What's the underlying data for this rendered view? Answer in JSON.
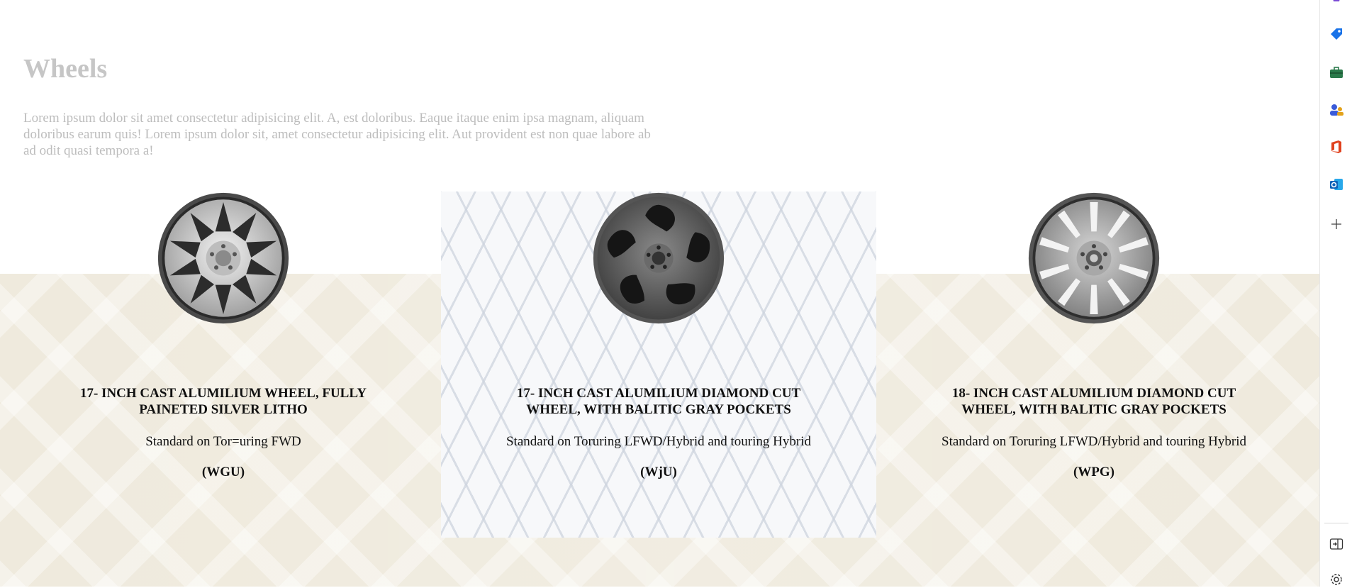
{
  "section": {
    "title": "Wheels",
    "description": "Lorem ipsum dolor sit amet consectetur adipisicing elit. A, est doloribus. Eaque itaque enim ipsa magnam, aliquam doloribus earum quis! Lorem ipsum dolor sit, amet consectetur adipisicing elit. Aut provident est non quae labore ab ad odit quasi tempora a!"
  },
  "cards": [
    {
      "title": "17- INCH CAST ALUMILIUM WHEEL, FULLY PAINETED SILVER LITHO",
      "subtitle": "Standard on Tor=uring FWD",
      "code": "(WGU)"
    },
    {
      "title": "17- INCH CAST ALUMILIUM DIAMOND CUT WHEEL, WITH BALITIC GRAY POCKETS",
      "subtitle": "Standard on Toruring LFWD/Hybrid and touring Hybrid",
      "code": "(WjU)"
    },
    {
      "title": "18- INCH CAST ALUMILIUM DIAMOND CUT WHEEL, WITH BALITIC GRAY POCKETS",
      "subtitle": "Standard on Toruring LFWD/Hybrid and touring Hybrid",
      "code": "(WPG)"
    }
  ],
  "sidebar": {
    "icons": [
      "copilot-icon",
      "shopping-tag-icon",
      "toolbox-icon",
      "people-icon",
      "office-icon",
      "outlook-icon",
      "add-icon",
      "split-screen-icon",
      "settings-icon"
    ]
  },
  "colors": {
    "beige_band": "#efeadd",
    "heading_gray": "#c6c6c6",
    "selected_card_bg": "#f7f8fa"
  }
}
